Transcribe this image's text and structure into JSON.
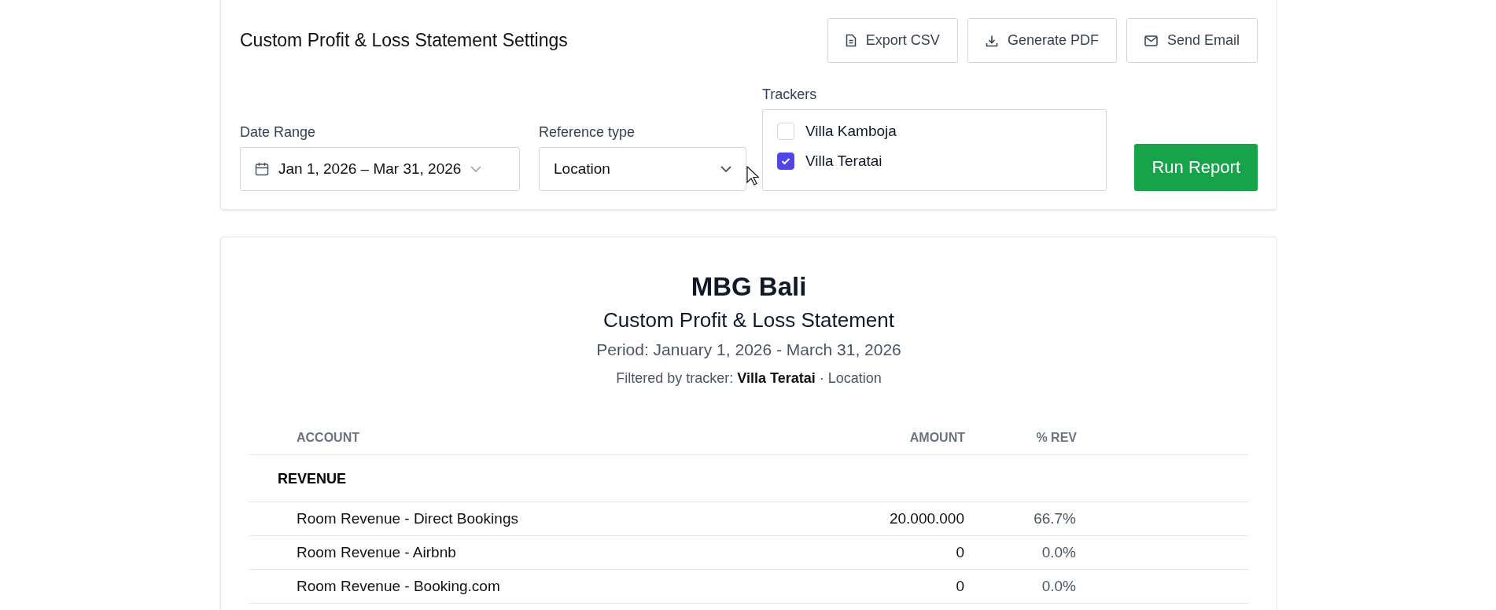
{
  "settings": {
    "title": "Custom Profit & Loss Statement Settings",
    "actions": [
      {
        "label": "Export CSV",
        "kind": "document"
      },
      {
        "label": "Generate PDF",
        "kind": "download"
      },
      {
        "label": "Send Email",
        "kind": "mail"
      }
    ],
    "date_range": {
      "label": "Date Range",
      "value": "Jan 1, 2026 – Mar 31, 2026"
    },
    "reference_type": {
      "label": "Reference type",
      "value": "Location"
    },
    "trackers": {
      "label": "Trackers",
      "items": [
        {
          "label": "Villa Kamboja",
          "checked": false
        },
        {
          "label": "Villa Teratai",
          "checked": true
        }
      ]
    },
    "run_button": "Run Report"
  },
  "report": {
    "company": "MBG Bali",
    "title": "Custom Profit & Loss Statement",
    "period": "Period: January 1, 2026 - March 31, 2026",
    "filter": "Filtered by tracker: **Villa Teratai** · Location",
    "columns": [
      "ACCOUNT",
      "AMOUNT",
      "% REV"
    ],
    "sections": [
      {
        "heading": "REVENUE",
        "rows": [
          {
            "account": "Room Revenue - Direct Bookings",
            "amount": "20.000.000",
            "percent": "66.7%"
          },
          {
            "account": "Room Revenue - Airbnb",
            "amount": "0",
            "percent": "0.0%"
          },
          {
            "account": "Room Revenue - Booking.com",
            "amount": "0",
            "percent": "0.0%"
          }
        ]
      }
    ]
  }
}
